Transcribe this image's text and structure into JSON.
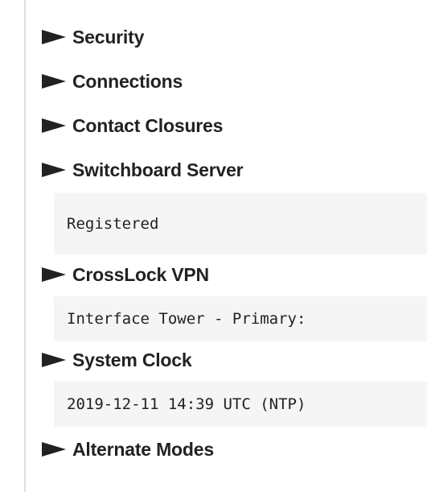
{
  "sections": [
    {
      "label": "Security",
      "value": null
    },
    {
      "label": "Connections",
      "value": null
    },
    {
      "label": "Contact Closures",
      "value": null
    },
    {
      "label": "Switchboard Server",
      "value": "Registered"
    },
    {
      "label": "CrossLock VPN",
      "value": "Interface Tower - Primary:"
    },
    {
      "label": "System Clock",
      "value": "2019-12-11 14:39 UTC (NTP)"
    },
    {
      "label": "Alternate Modes",
      "value": null
    }
  ],
  "icons": {
    "expand": "caret-right-icon"
  },
  "colors": {
    "text": "#222222",
    "value_background": "#f5f5f5",
    "border": "#e0e0e0"
  }
}
